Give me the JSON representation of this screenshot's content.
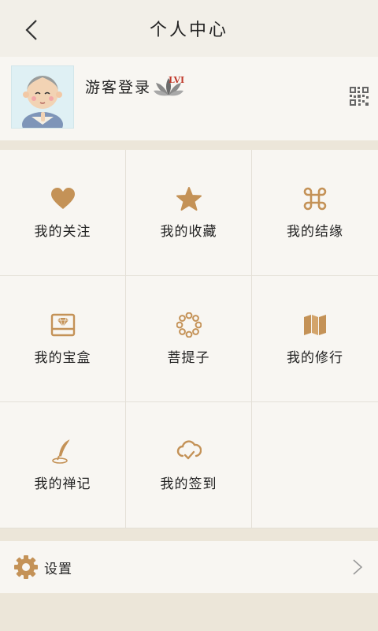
{
  "header": {
    "title": "个人中心"
  },
  "profile": {
    "username": "游客登录",
    "level": "LVI"
  },
  "menu": [
    {
      "label": "我的关注",
      "icon": "heart-icon"
    },
    {
      "label": "我的收藏",
      "icon": "star-icon"
    },
    {
      "label": "我的结缘",
      "icon": "command-knot-icon"
    },
    {
      "label": "我的宝盒",
      "icon": "treasure-box-icon"
    },
    {
      "label": "菩提子",
      "icon": "bead-bracelet-icon"
    },
    {
      "label": "我的修行",
      "icon": "map-icon"
    },
    {
      "label": "我的禅记",
      "icon": "quill-pen-icon"
    },
    {
      "label": "我的签到",
      "icon": "cloud-check-icon"
    }
  ],
  "settings": {
    "label": "设置"
  },
  "colors": {
    "accent": "#c49257",
    "background": "#ece6d9",
    "panel": "#f8f6f2"
  }
}
